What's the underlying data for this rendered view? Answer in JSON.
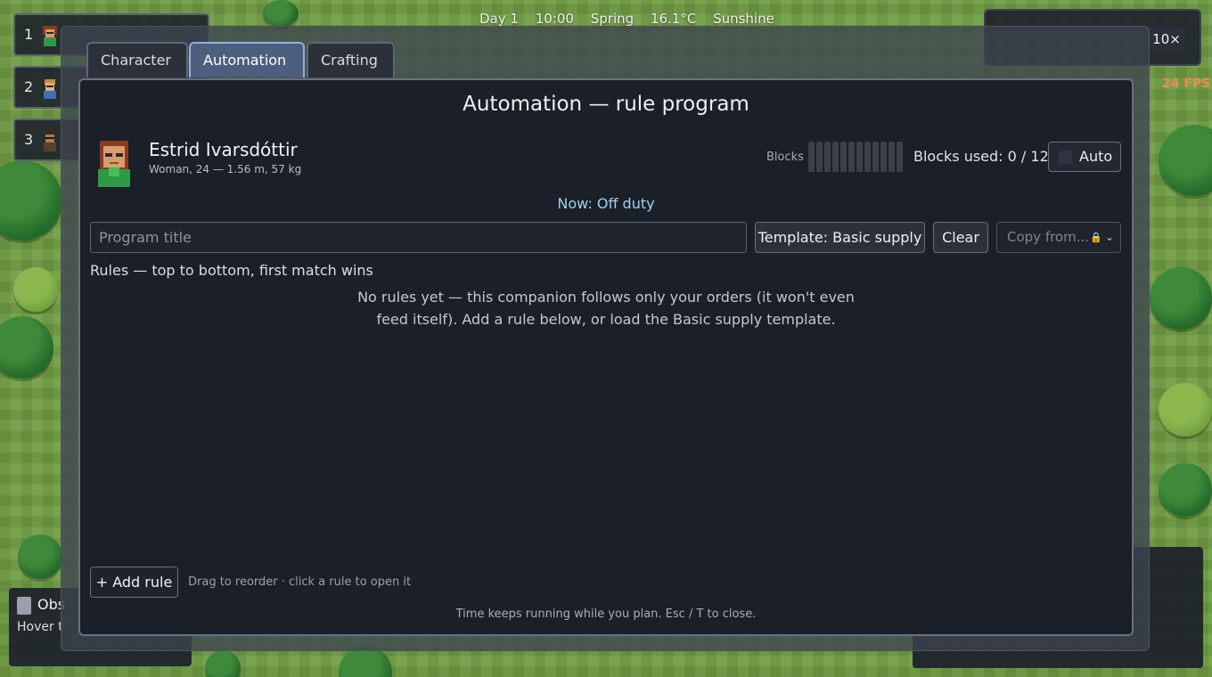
{
  "hud": {
    "day": "Day 1",
    "time": "10:00",
    "season": "Spring",
    "temperature": "16.1°C",
    "weather": "Sunshine",
    "speed_label": "10×",
    "fps_text": "24 FPS"
  },
  "party": [
    {
      "slot": "1"
    },
    {
      "slot": "2"
    },
    {
      "slot": "3"
    }
  ],
  "bottom_left": {
    "title": "Obs",
    "hint": "Hover t"
  },
  "tabs": [
    {
      "label": "Character",
      "active": false
    },
    {
      "label": "Automation",
      "active": true
    },
    {
      "label": "Crafting",
      "active": false
    }
  ],
  "panel": {
    "title": "Automation — rule program",
    "character": {
      "name": "Estrid Ivarsdóttir",
      "details": "Woman, 24 — 1.56 m, 57 kg"
    },
    "blocks_label": "Blocks",
    "blocks_used_text": "Blocks used: 0 / 12",
    "blocks_used": 0,
    "blocks_total": 12,
    "auto_label": "Auto",
    "auto_checked": false,
    "status": "Now: Off duty",
    "program_title_placeholder": "Program title",
    "template_button": "Template: Basic supply",
    "clear_button": "Clear",
    "copy_from_label": "Copy from...",
    "rules_heading": "Rules — top to bottom, first match wins",
    "empty_message_line1": "No rules yet — this companion follows only your orders (it won't even",
    "empty_message_line2": "feed itself). Add a rule below, or load the Basic supply template.",
    "add_rule_button": "+ Add rule",
    "drag_hint": "Drag to reorder · click a rule to open it",
    "footer": "Time keeps running while you plan.   Esc / T to close."
  },
  "colors": {
    "accent_tab": "#8fb0e6",
    "status_text": "#9ed2ef",
    "panel_bg": "#1b1f28",
    "fps": "#f28b4c"
  }
}
